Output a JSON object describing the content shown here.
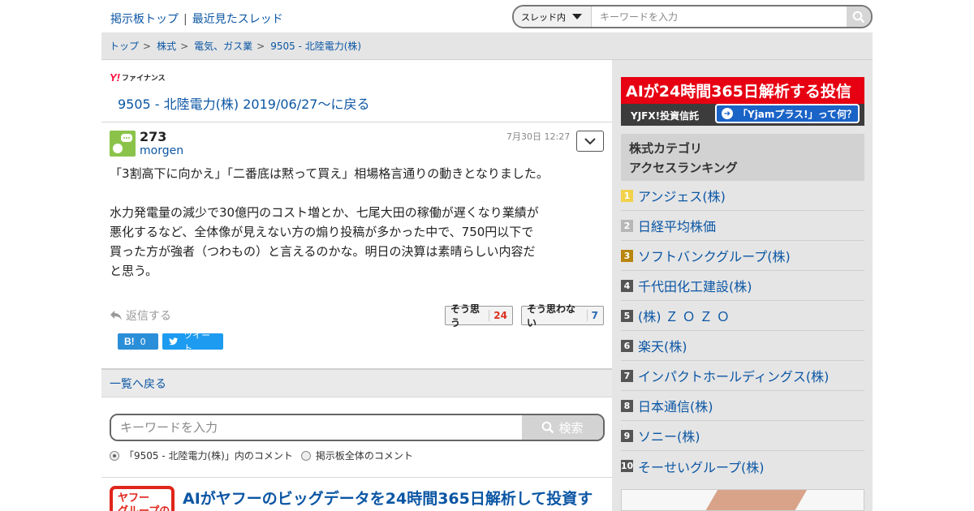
{
  "header": {
    "links": [
      "掲示板トップ",
      "最近見たスレッド"
    ],
    "separator": "|",
    "search_scope": "スレッド内",
    "search_placeholder": "キーワードを入力"
  },
  "breadcrumb": [
    "トップ",
    "株式",
    "電気、ガス業",
    "9505 - 北陸電力(株)"
  ],
  "logo_text": "ファイナンス",
  "back_link": "9505 - 北陸電力(株) 2019/06/27〜に戻る",
  "post": {
    "number": "273",
    "user": "morgen",
    "time": "7月30日 12:27",
    "paragraphs": [
      "「3割高下に向かえ」「二番底は黙って買え」相場格言通りの動きとなりました。",
      "水力発電量の減少で30億円のコスト増とか、七尾大田の稼働が遅くなり業績が\n悪化するなど、全体像が見えない方の煽り投稿が多かった中で、750円以下で\n買った方が強者（つわもの）と言えるのかな。明日の決算は素晴らしい内容だ\nと思う。"
    ],
    "reply_label": "返信する",
    "vote_yes_label": "そう思う",
    "vote_yes_count": "24",
    "vote_no_label": "そう思わない",
    "vote_no_count": "7",
    "hatena_count": "0",
    "tweet_label": "ツイート"
  },
  "list_back": "一覧へ戻る",
  "bottom_search": {
    "placeholder": "キーワードを入力",
    "button": "検索",
    "radio1": "「9505 - 北陸電力(株)」内のコメント",
    "radio2": "掲示板全体のコメント"
  },
  "promo": {
    "badge": "ヤフー\nグループの",
    "title": "AIがヤフーのビッグデータを24時間365日解析して投資す"
  },
  "sidebar": {
    "ad_headline": "AIが24時間365日解析する投信",
    "ad_sub": "YJFX!投資信託",
    "ad_button": "「Yjamプラス!」って何？",
    "ranking_title_1": "株式カテゴリ",
    "ranking_title_2": "アクセスランキング",
    "ranking": [
      {
        "rank": "1",
        "name": "アンジェス(株)"
      },
      {
        "rank": "2",
        "name": "日経平均株価"
      },
      {
        "rank": "3",
        "name": "ソフトバンクグループ(株)"
      },
      {
        "rank": "4",
        "name": "千代田化工建設(株)"
      },
      {
        "rank": "5",
        "name": "(株) Ｚ Ｏ Ｚ Ｏ"
      },
      {
        "rank": "6",
        "name": "楽天(株)"
      },
      {
        "rank": "7",
        "name": "インパクトホールディングス(株)"
      },
      {
        "rank": "8",
        "name": "日本通信(株)"
      },
      {
        "rank": "9",
        "name": "ソニー(株)"
      },
      {
        "rank": "10",
        "name": "そーせいグループ(株)"
      }
    ]
  }
}
